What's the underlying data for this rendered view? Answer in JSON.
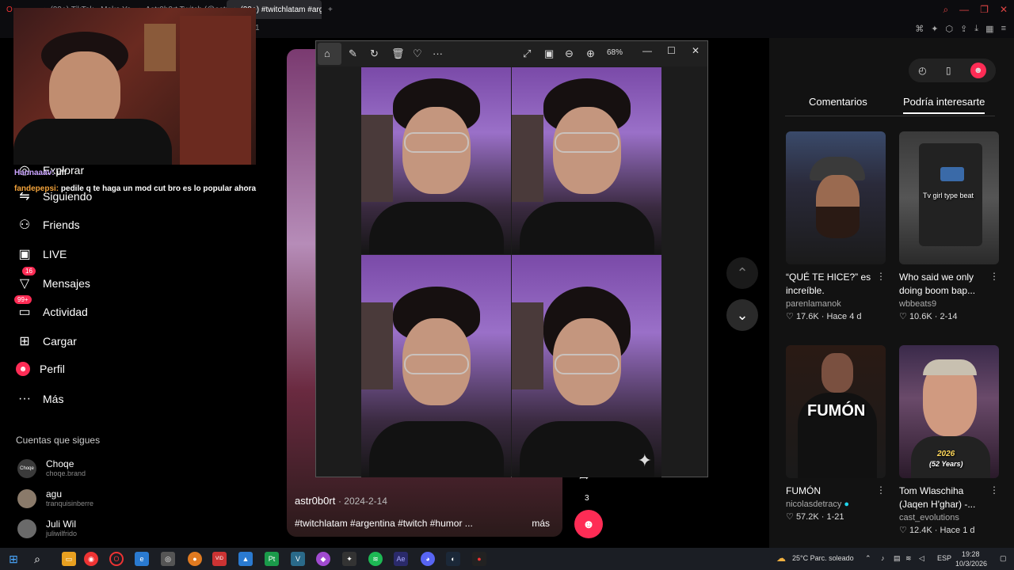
{
  "browser": {
    "tabs": [
      {
        "title": "(99+) TikTok - Make Your Day"
      },
      {
        "title": "Astr0b0rt Twitch (@astr0b0rt)"
      },
      {
        "title": "(99+) #twitchlatam #argentina"
      }
    ],
    "new_tab": "+",
    "address_fragment": "1"
  },
  "chat": [
    {
      "user": "Hannaaav:",
      "message": "uff"
    },
    {
      "user": "fandepepsi:",
      "message": "pedile q te haga un mod cut bro es lo popular ahora"
    }
  ],
  "sidebar": {
    "items": [
      {
        "label": "Explorar",
        "icon": "compass-icon"
      },
      {
        "label": "Siguiendo",
        "icon": "following-icon"
      },
      {
        "label": "Friends",
        "icon": "friends-icon"
      },
      {
        "label": "LIVE",
        "icon": "live-icon"
      },
      {
        "label": "Mensajes",
        "icon": "messages-icon",
        "badge": "16"
      },
      {
        "label": "Actividad",
        "icon": "activity-icon",
        "badge": "99+"
      },
      {
        "label": "Cargar",
        "icon": "upload-icon"
      },
      {
        "label": "Perfil",
        "icon": "profile-icon"
      },
      {
        "label": "Más",
        "icon": "more-icon"
      }
    ],
    "following_title": "Cuentas que sigues",
    "following": [
      {
        "name": "Choqe",
        "handle": "choqe.brand",
        "avatar_text": "Choqe"
      },
      {
        "name": "agu",
        "handle": "tranquisinberre"
      },
      {
        "name": "Juli Wil",
        "handle": "juliwilfrido"
      }
    ]
  },
  "video": {
    "author": "astr0b0rt",
    "date": "· 2024-2-14",
    "tags": "#twitchlatam #argentina #twitch #humor ...",
    "more": "más",
    "share_count": "3"
  },
  "viewer": {
    "zoom": "68%",
    "toolbar_icons": [
      "home-icon",
      "edit-icon",
      "rotate-icon",
      "delete-icon",
      "favorite-icon",
      "more-options-icon",
      "expand-icon",
      "fit-icon",
      "zoom-out-icon",
      "zoom-in-icon"
    ]
  },
  "right_panel": {
    "tabs": [
      "Comentarios",
      "Podría interesarte"
    ],
    "active_tab": 1,
    "cards": [
      {
        "title": "“QUÉ TE HICE?” es increíble.",
        "author": "parenlamanok",
        "likes": "17.6K",
        "date": "Hace 4 d",
        "thumb_text": ""
      },
      {
        "title": "Who said we only doing boom bap...",
        "author": "wbbeats9",
        "likes": "10.6K",
        "date": "2-14",
        "thumb_text": "Tv girl type beat"
      },
      {
        "title": "FUMÓN",
        "author": "nicolasdetracy",
        "likes": "57.2K",
        "date": "1-21",
        "thumb_text": "FUMÓN",
        "verified": true
      },
      {
        "title": "Tom Wlaschiha (Jaqen H'ghar) -...",
        "author": "cast_evolutions",
        "likes": "12.4K",
        "date": "Hace 1 d",
        "thumb_text": "2026",
        "thumb_sub": "(52 Years)"
      }
    ]
  },
  "taskbar": {
    "weather": "25°C  Parc. soleado",
    "lang": "ESP",
    "time": "19:28",
    "date": "10/3/2026"
  },
  "colors": {
    "accent": "#fe2c55",
    "panel": "#121212"
  }
}
